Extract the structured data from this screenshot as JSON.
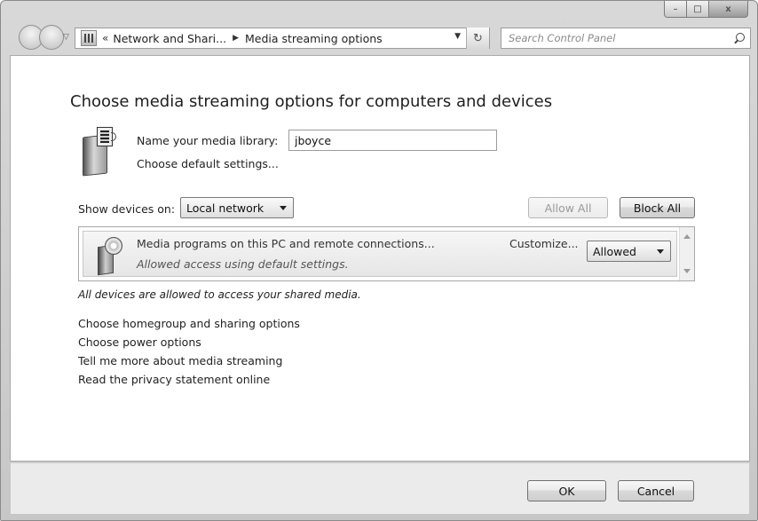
{
  "titlebar": {
    "minimize_glyph": "–",
    "maximize_glyph": "□",
    "close_glyph": "x"
  },
  "nav": {
    "breadcrumb_overflow": "«",
    "breadcrumb_parent": "Network and Shari...",
    "breadcrumb_separator": "▶",
    "breadcrumb_current": "Media streaming options",
    "refresh_glyph": "↻",
    "search_placeholder": "Search Control Panel"
  },
  "main": {
    "heading": "Choose media streaming options for computers and devices",
    "library_label": "Name your media library:",
    "library_value": "jboyce",
    "default_settings_link": "Choose default settings...",
    "show_devices_label": "Show devices on:",
    "network_select": "Local network",
    "allow_all_label": "Allow All",
    "block_all_label": "Block All",
    "device": {
      "title": "Media programs on this PC and remote connections...",
      "status": "Allowed access using default settings.",
      "customize_label": "Customize...",
      "access_select": "Allowed"
    },
    "all_allowed_note": "All devices are allowed to access your shared media.",
    "links": [
      "Choose homegroup and sharing options",
      "Choose power options",
      "Tell me more about media streaming",
      "Read the privacy statement online"
    ]
  },
  "footer": {
    "ok_label": "OK",
    "cancel_label": "Cancel"
  }
}
